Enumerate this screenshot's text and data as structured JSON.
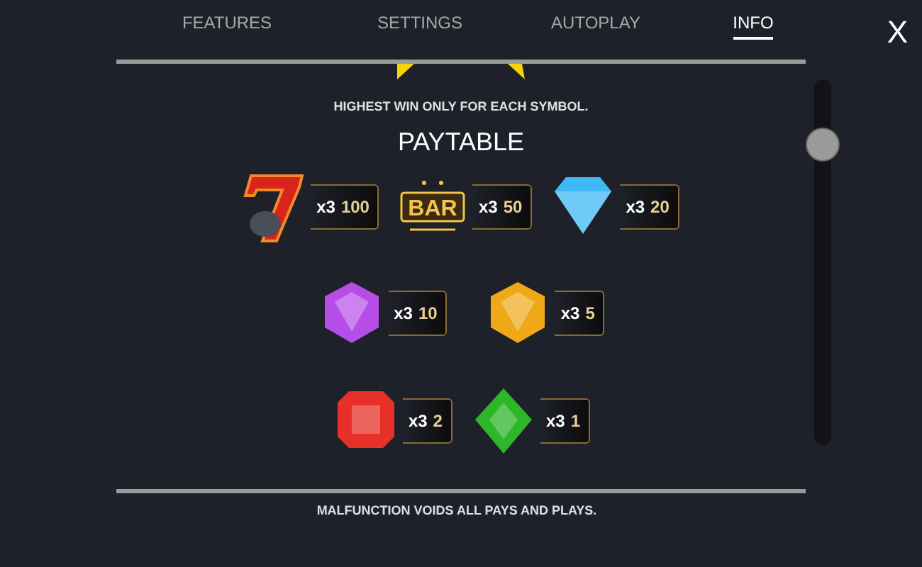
{
  "tabs": [
    {
      "label": "FEATURES",
      "selected": false
    },
    {
      "label": "SETTINGS",
      "selected": false
    },
    {
      "label": "AUTOPLAY",
      "selected": false
    },
    {
      "label": "INFO",
      "selected": true
    }
  ],
  "close": "X",
  "note": "HIGHEST WIN ONLY FOR EACH SYMBOL.",
  "heading": "PAYTABLE",
  "paytable": [
    [
      {
        "kind": "seven",
        "count": "x3",
        "payout": "100"
      },
      {
        "kind": "bar",
        "label": "BAR",
        "count": "x3",
        "payout": "50"
      },
      {
        "kind": "diamond",
        "color": "#3fb8f5",
        "count": "x3",
        "payout": "20"
      }
    ],
    [
      {
        "kind": "hexagon",
        "color": "#b64de8",
        "count": "x3",
        "payout": "10"
      },
      {
        "kind": "hexagon",
        "color": "#f0a818",
        "count": "x3",
        "payout": "5"
      }
    ],
    [
      {
        "kind": "octagon",
        "color": "#e8302a",
        "count": "x3",
        "payout": "2"
      },
      {
        "kind": "rhombus",
        "color": "#2fb52a",
        "count": "x3",
        "payout": "1"
      }
    ]
  ],
  "footer": "MALFUNCTION VOIDS ALL PAYS AND PLAYS."
}
